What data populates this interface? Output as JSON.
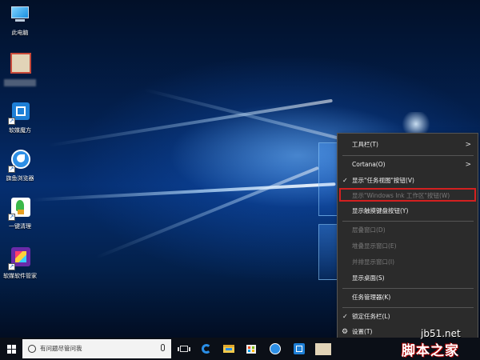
{
  "desktop": {
    "icons": [
      {
        "label": "此电脑",
        "icon": "computer-icon"
      },
      {
        "label": "",
        "icon": "blurred-file-icon"
      },
      {
        "label": "软媒魔方",
        "icon": "app-cube-icon"
      },
      {
        "label": "旗鱼浏览器",
        "icon": "browser-icon"
      },
      {
        "label": "一键清理",
        "icon": "cleaner-icon"
      },
      {
        "label": "软媒软件管家",
        "icon": "software-manager-icon"
      }
    ]
  },
  "context_menu": {
    "items": [
      {
        "label": "工具栏(T)",
        "submenu": true
      },
      {
        "label": "Cortana(O)",
        "submenu": true
      },
      {
        "label": "显示\"任务视图\"按钮(V)",
        "checked": true
      },
      {
        "label": "显示\"Windows Ink 工作区\"按钮(W)",
        "disabled": true
      },
      {
        "label": "显示触摸键盘按钮(Y)"
      },
      {
        "label": "层叠窗口(D)",
        "disabled": true
      },
      {
        "label": "堆叠显示窗口(E)",
        "disabled": true
      },
      {
        "label": "并排显示窗口(I)",
        "disabled": true
      },
      {
        "label": "显示桌面(S)"
      },
      {
        "label": "任务管理器(K)"
      },
      {
        "label": "锁定任务栏(L)",
        "checked": true
      },
      {
        "label": "设置(T)",
        "icon": "gear-icon"
      }
    ],
    "highlight_color": "#d32020"
  },
  "taskbar": {
    "search_placeholder": "有问题尽管问我",
    "apps": [
      "task-view-icon",
      "edge-icon",
      "file-explorer-icon",
      "store-icon",
      "browser-icon",
      "app-cube-icon",
      "file-icon"
    ]
  },
  "watermark": {
    "site": "jb51.net",
    "brand": "脚本之家"
  },
  "colors": {
    "menu_bg": "#2b2b2b",
    "taskbar_bg": "#0b0f17",
    "desktop_blue": "#052e70"
  }
}
